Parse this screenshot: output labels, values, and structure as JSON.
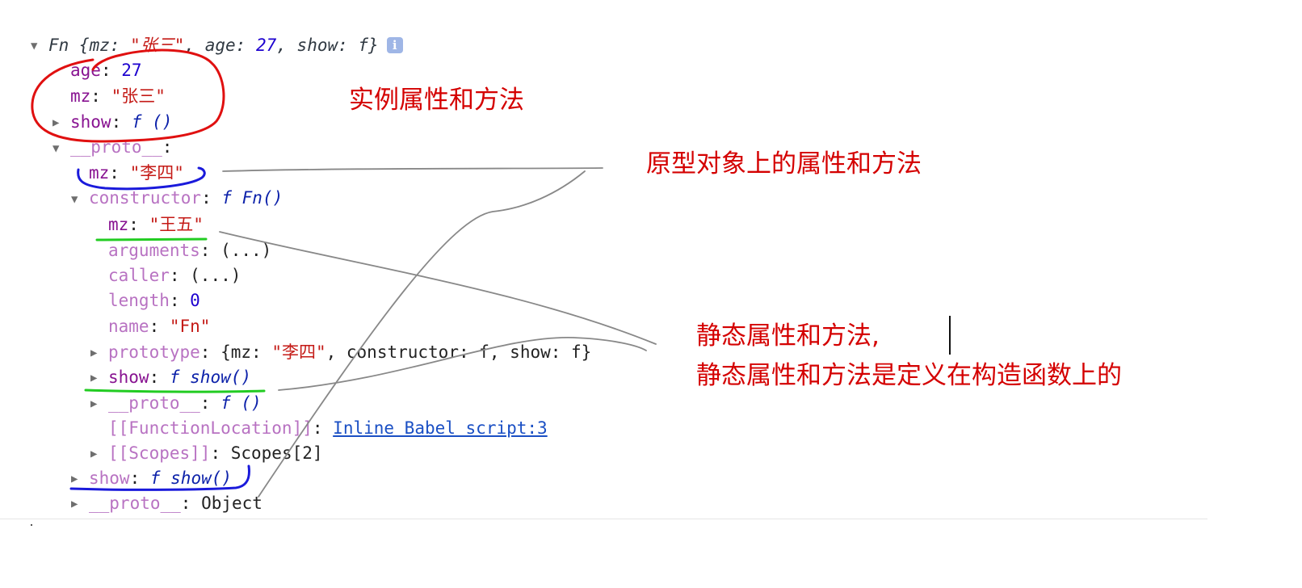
{
  "tree": {
    "root": {
      "prefix": "Fn {mz: ",
      "mz": "\"张三\"",
      "mid": ", age: ",
      "age": "27",
      "rest": ", show: f}",
      "info_icon": "i"
    },
    "age": {
      "key": "age",
      "sep": ": ",
      "value": "27"
    },
    "mz": {
      "key": "mz",
      "sep": ": ",
      "value": "\"张三\""
    },
    "show": {
      "key": "show",
      "sep": ": ",
      "value": "f ()"
    },
    "proto": {
      "key": "__proto__",
      "sep": ":"
    },
    "proto_mz": {
      "key": "mz",
      "sep": ": ",
      "value": "\"李四\""
    },
    "constructor": {
      "key": "constructor",
      "sep": ": ",
      "value": "f Fn()"
    },
    "static_mz": {
      "key": "mz",
      "sep": ": ",
      "value": "\"王五\""
    },
    "arguments": {
      "key": "arguments",
      "sep": ": ",
      "value": "(...)"
    },
    "caller": {
      "key": "caller",
      "sep": ": ",
      "value": "(...)"
    },
    "length": {
      "key": "length",
      "sep": ": ",
      "value": "0"
    },
    "name": {
      "key": "name",
      "sep": ": ",
      "value": "\"Fn\""
    },
    "prototype": {
      "key": "prototype",
      "sep": ": ",
      "open": "{mz: ",
      "mz": "\"李四\"",
      "rest": ", constructor: f, show: f}"
    },
    "static_show": {
      "key": "show",
      "sep": ": ",
      "value": "f show()"
    },
    "ctor_proto": {
      "key": "__proto__",
      "sep": ": ",
      "value": "f ()"
    },
    "function_location": {
      "key": "[[FunctionLocation]]",
      "sep": ": ",
      "value": "Inline Babel script:3"
    },
    "scopes": {
      "key": "[[Scopes]]",
      "sep": ": ",
      "value": "Scopes[2]"
    },
    "proto_show": {
      "key": "show",
      "sep": ": ",
      "value": "f show()"
    },
    "proto_proto": {
      "key": "__proto__",
      "sep": ": ",
      "value": "Object"
    }
  },
  "annotations": {
    "instance": "实例属性和方法",
    "prototype": "原型对象上的属性和方法",
    "static_line1": "静态属性和方法,",
    "static_line2": "静态属性和方法是定义在构造函数上的"
  },
  "colors": {
    "annotation_text": "#d40000",
    "red_circle": "#e01010",
    "blue_underline": "#1a1adb",
    "green_underline": "#22cc22",
    "connector_lines": "#888888"
  }
}
